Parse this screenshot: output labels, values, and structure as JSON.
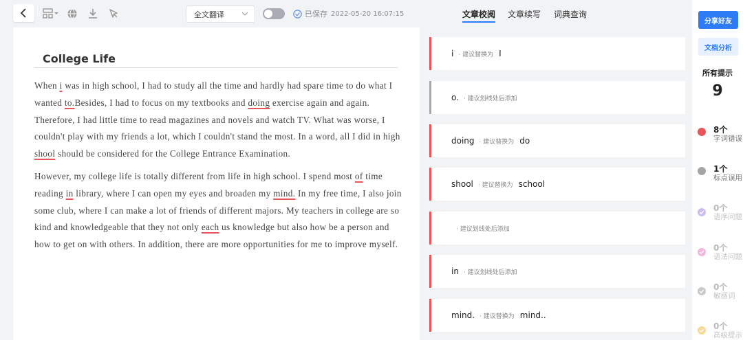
{
  "toolbar": {
    "translate_select": "全文翻译",
    "saved_label": "已保存",
    "saved_time": "2022-05-20 16:07:15",
    "tabs": [
      {
        "label": "文章校阅",
        "active": true
      },
      {
        "label": "文章续写",
        "active": false
      },
      {
        "label": "词典查询",
        "active": false
      }
    ]
  },
  "document": {
    "title": "College Life",
    "p1": [
      {
        "t": "When "
      },
      {
        "t": "i",
        "e": true
      },
      {
        "t": " was in high school, I had to study all the time and hardly had spare time to do what I wanted "
      },
      {
        "t": "to.",
        "e": true
      },
      {
        "t": "Besides, I had to focus on my textbooks and "
      },
      {
        "t": "doing",
        "e": true
      },
      {
        "t": " exercise again and again. Therefore, I had little time to read magazines and novels and watch TV. What was worse, I couldn't play with my friends a lot, which I couldn't stand the most. In a word, all I did in high "
      },
      {
        "t": "shool",
        "e": true
      },
      {
        "t": " should be considered for the College Entrance Examination."
      }
    ],
    "p2": [
      {
        "t": "However, my college life is totally different from life in high school. I spend most "
      },
      {
        "t": "of",
        "e": true
      },
      {
        "t": " time reading "
      },
      {
        "t": "in",
        "e": true
      },
      {
        "t": " library, where I can open my eyes and broaden my "
      },
      {
        "t": "mind.",
        "e": true
      },
      {
        "t": " In my free time, I also join some club, where I can make a lot of friends of different majors. My teachers in college are so kind and knowledgeable that they not only "
      },
      {
        "t": "each",
        "e": true
      },
      {
        "t": " us knowledge but also how be a person and how to get on with others. In addition, there are more opportunities for me to improve myself."
      }
    ]
  },
  "suggestions": [
    {
      "word": "i",
      "hint": "· 建议替换为",
      "rep": "I",
      "border": "red"
    },
    {
      "word": "o.",
      "hint": "· 建议划线处后添加",
      "rep": "",
      "border": "gray"
    },
    {
      "word": "doing",
      "hint": "· 建议替换为",
      "rep": "do",
      "border": "red"
    },
    {
      "word": "shool",
      "hint": "· 建议替换为",
      "rep": "school",
      "border": "red"
    },
    {
      "word": "",
      "hint": "· 建议划线处后添加",
      "rep": "",
      "border": "red"
    },
    {
      "word": "in",
      "hint": "· 建议划线处后添加",
      "rep": "",
      "border": "red"
    },
    {
      "word": "mind.",
      "hint": "· 建议替换为",
      "rep": "mind..",
      "border": "red"
    }
  ],
  "right_panel": {
    "share_label": "分享好友",
    "analyze_label": "文档分析",
    "all_label": "所有提示",
    "all_count": "9",
    "categories": [
      {
        "count": "8个",
        "name": "字词错误",
        "color": "#e8545a",
        "faded": false,
        "icon": "dot-icon"
      },
      {
        "count": "1个",
        "name": "标点误用",
        "color": "#a5a5a5",
        "faded": false,
        "icon": "dot-icon"
      },
      {
        "count": "0个",
        "name": "语序问题",
        "color": "#cbbdf3",
        "faded": true,
        "icon": "check-circle-icon"
      },
      {
        "count": "0个",
        "name": "语法问题",
        "color": "#f3b6dc",
        "faded": true,
        "icon": "check-circle-icon"
      },
      {
        "count": "0个",
        "name": "敏感词",
        "color": "#c9c9c9",
        "faded": true,
        "icon": "check-circle-icon"
      },
      {
        "count": "0个",
        "name": "高级提示",
        "color": "#f6d995",
        "faded": true,
        "icon": "check-circle-icon"
      }
    ]
  }
}
